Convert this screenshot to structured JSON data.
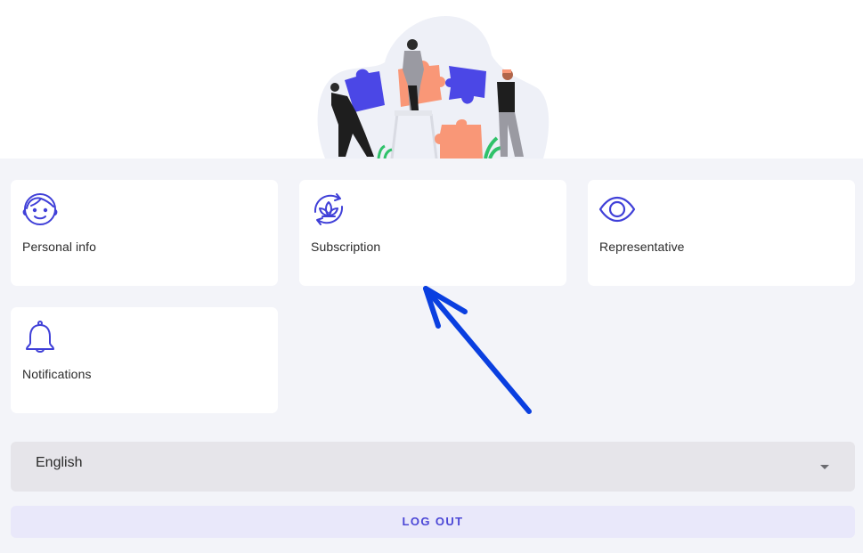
{
  "cards": [
    {
      "id": "personal-info",
      "label": "Personal info",
      "icon": "face-icon"
    },
    {
      "id": "subscription",
      "label": "Subscription",
      "icon": "lotus-refresh-icon"
    },
    {
      "id": "representative",
      "label": "Representative",
      "icon": "eye-icon"
    },
    {
      "id": "notifications",
      "label": "Notifications",
      "icon": "bell-icon"
    }
  ],
  "language_select": {
    "value": "English",
    "icon": "dropdown-caret-icon"
  },
  "logout": {
    "label": "LOG OUT"
  },
  "colors": {
    "accent": "#4b47d6",
    "icon": "#4040d8",
    "page_background": "#f3f4f9",
    "card_background": "#ffffff",
    "select_background": "#e6e5ea",
    "logout_background": "#e9e8fa",
    "annotation_arrow": "#0a3fe0"
  },
  "illustration": {
    "name": "team-puzzle-illustration"
  }
}
